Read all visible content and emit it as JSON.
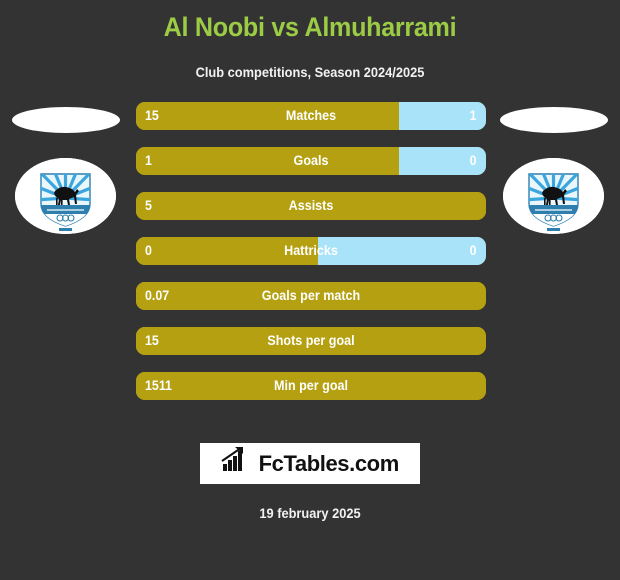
{
  "header": {
    "title": "Al Noobi vs Almuharrami",
    "subtitle": "Club competitions, Season 2024/2025",
    "title_color": "#9CCC45"
  },
  "crests": {
    "home": {
      "name": "Al Noobi",
      "icon": "club-crest-icon"
    },
    "away": {
      "name": "Almuharrami",
      "icon": "club-crest-icon"
    }
  },
  "footer": {
    "brand": "FcTables.com",
    "brand_icon": "bar-chart-icon",
    "date": "19 february 2025"
  },
  "chart_data": {
    "type": "bar",
    "title": "Al Noobi vs Almuharrami",
    "subtitle": "Club competitions, Season 2024/2025",
    "xlabel": "",
    "ylabel": "",
    "grid": false,
    "legend": "none",
    "orientation": "horizontal-paired",
    "colors": {
      "home": "#B5A012",
      "away": "#A8E3FA",
      "background": "#333333",
      "text": "#ffffff",
      "accent": "#9CCC45"
    },
    "categories": [
      "Matches",
      "Goals",
      "Assists",
      "Hattricks",
      "Goals per match",
      "Shots per goal",
      "Min per goal"
    ],
    "series": [
      {
        "name": "Al Noobi",
        "values": [
          "15",
          "1",
          "5",
          "0",
          "0.07",
          "15",
          "1511"
        ]
      },
      {
        "name": "Almuharrami",
        "values": [
          "1",
          "0",
          "",
          "0",
          "",
          "",
          ""
        ]
      }
    ],
    "rows": [
      {
        "label": "Matches",
        "home_value": "15",
        "away_value": "1",
        "home_pct": 75,
        "away_pct": 25,
        "has_away": true
      },
      {
        "label": "Goals",
        "home_value": "1",
        "away_value": "0",
        "home_pct": 75,
        "away_pct": 25,
        "has_away": true
      },
      {
        "label": "Assists",
        "home_value": "5",
        "away_value": "",
        "home_pct": 100,
        "away_pct": 0,
        "has_away": false
      },
      {
        "label": "Hattricks",
        "home_value": "0",
        "away_value": "0",
        "home_pct": 52,
        "away_pct": 48,
        "has_away": true
      },
      {
        "label": "Goals per match",
        "home_value": "0.07",
        "away_value": "",
        "home_pct": 100,
        "away_pct": 0,
        "has_away": false
      },
      {
        "label": "Shots per goal",
        "home_value": "15",
        "away_value": "",
        "home_pct": 100,
        "away_pct": 0,
        "has_away": false
      },
      {
        "label": "Min per goal",
        "home_value": "1511",
        "away_value": "",
        "home_pct": 100,
        "away_pct": 0,
        "has_away": false
      }
    ]
  }
}
